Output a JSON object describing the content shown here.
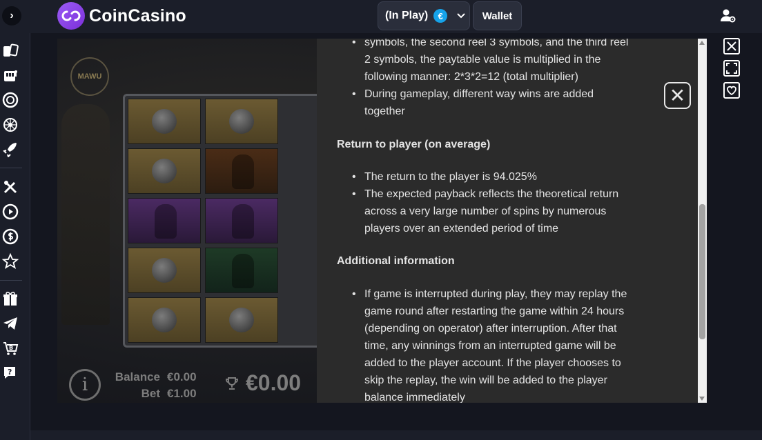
{
  "brand": {
    "name": "CoinCasino"
  },
  "header": {
    "play_mode": "(In Play)",
    "currency_symbol": "€",
    "wallet_label": "Wallet"
  },
  "game": {
    "logo_text": "MAWU",
    "balance_label": "Balance",
    "balance_value": "€0.00",
    "bet_label": "Bet",
    "bet_value": "€1.00",
    "win_value": "€0.00",
    "info_symbol": "i"
  },
  "info_panel": {
    "top_bullet": {
      "line1": "symbols, the second reel 3 symbols, and the third reel",
      "line2": "2 symbols, the paytable value is multiplied in the",
      "line3": "following manner: 2*3*2=12 (total multiplier)"
    },
    "bullet_way_wins": {
      "line1": "During gameplay, different way wins are added",
      "line2": "together"
    },
    "rtp_heading": "Return to player (on average)",
    "rtp_bullets": [
      {
        "line1": "The return to the player is 94.025%"
      },
      {
        "line1": "The expected payback reflects the theoretical return",
        "line2": "across a very large number of spins by numerous",
        "line3": "players over an extended period of time"
      }
    ],
    "additional_heading": "Additional information",
    "additional_bullet": {
      "line1": "If game is interrupted during play, they may replay the",
      "line2": "game round after restarting the game within 24 hours",
      "line3": "(depending on operator) after interruption. After that",
      "line4": "time, any winnings from an interrupted game will be",
      "line5": "added to the player account. If the player chooses to",
      "line6": "skip the replay, the win will be added to the player",
      "line7": "balance immediately"
    },
    "close_symbol": "✕"
  },
  "left_rail": {
    "collapse_symbol": "›",
    "icons": [
      "cards-icon",
      "slot-machine-icon",
      "poker-chip-icon",
      "roulette-icon",
      "rocket-icon",
      "sports-icon",
      "play-circle-icon",
      "dollar-coin-icon",
      "star-icon",
      "gift-icon",
      "telegram-icon",
      "bitcoin-cart-icon",
      "help-chat-icon"
    ]
  },
  "side_controls": [
    "close-game-icon",
    "fullscreen-icon",
    "favorite-icon"
  ]
}
